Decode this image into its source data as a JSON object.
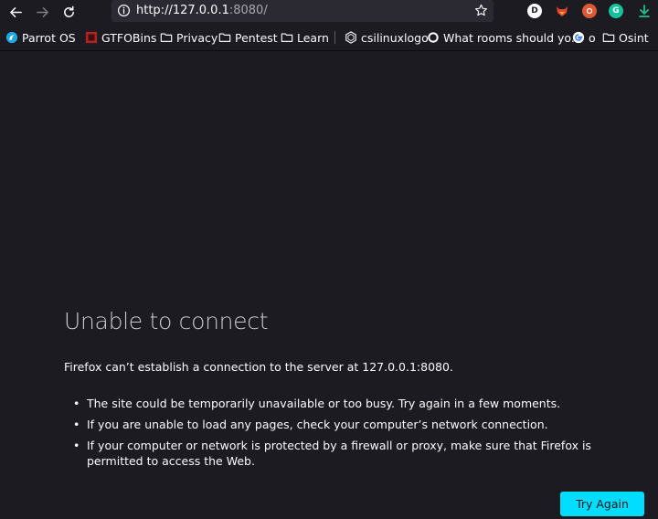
{
  "browser": {
    "url_host": "http://127.0.0.1",
    "url_rest": ":8080/"
  },
  "extensions": [
    {
      "name": "D",
      "color": "#ffffff"
    },
    {
      "name": "",
      "color": "#e2462b"
    },
    {
      "name": "",
      "color": "#de5833"
    },
    {
      "name": "G",
      "color": "#15c39a"
    },
    {
      "name": "",
      "color": "#21c08b"
    }
  ],
  "bookmarks": [
    {
      "label": "Parrot OS",
      "icon": "parrot-icon"
    },
    {
      "label": "GTFOBins",
      "icon": "gtfobins-icon"
    },
    {
      "label": "Privacy",
      "icon": "folder-icon"
    },
    {
      "label": "Pentest",
      "icon": "folder-icon"
    },
    {
      "label": "Learn",
      "icon": "folder-icon"
    },
    {
      "label": "csilinuxlogo",
      "icon": "csi-icon"
    },
    {
      "label": "What rooms should yo...",
      "icon": "circle-icon"
    },
    {
      "label": "o",
      "icon": "google-icon"
    },
    {
      "label": "Osint",
      "icon": "folder-icon"
    }
  ],
  "error": {
    "title": "Unable to connect",
    "lead": "Firefox can’t establish a connection to the server at 127.0.0.1:8080.",
    "items": [
      "The site could be temporarily unavailable or too busy. Try again in a few moments.",
      "If you are unable to load any pages, check your computer’s network connection.",
      "If your computer or network is protected by a firewall or proxy, make sure that Firefox is permitted to access the Web."
    ],
    "button": "Try Again"
  }
}
